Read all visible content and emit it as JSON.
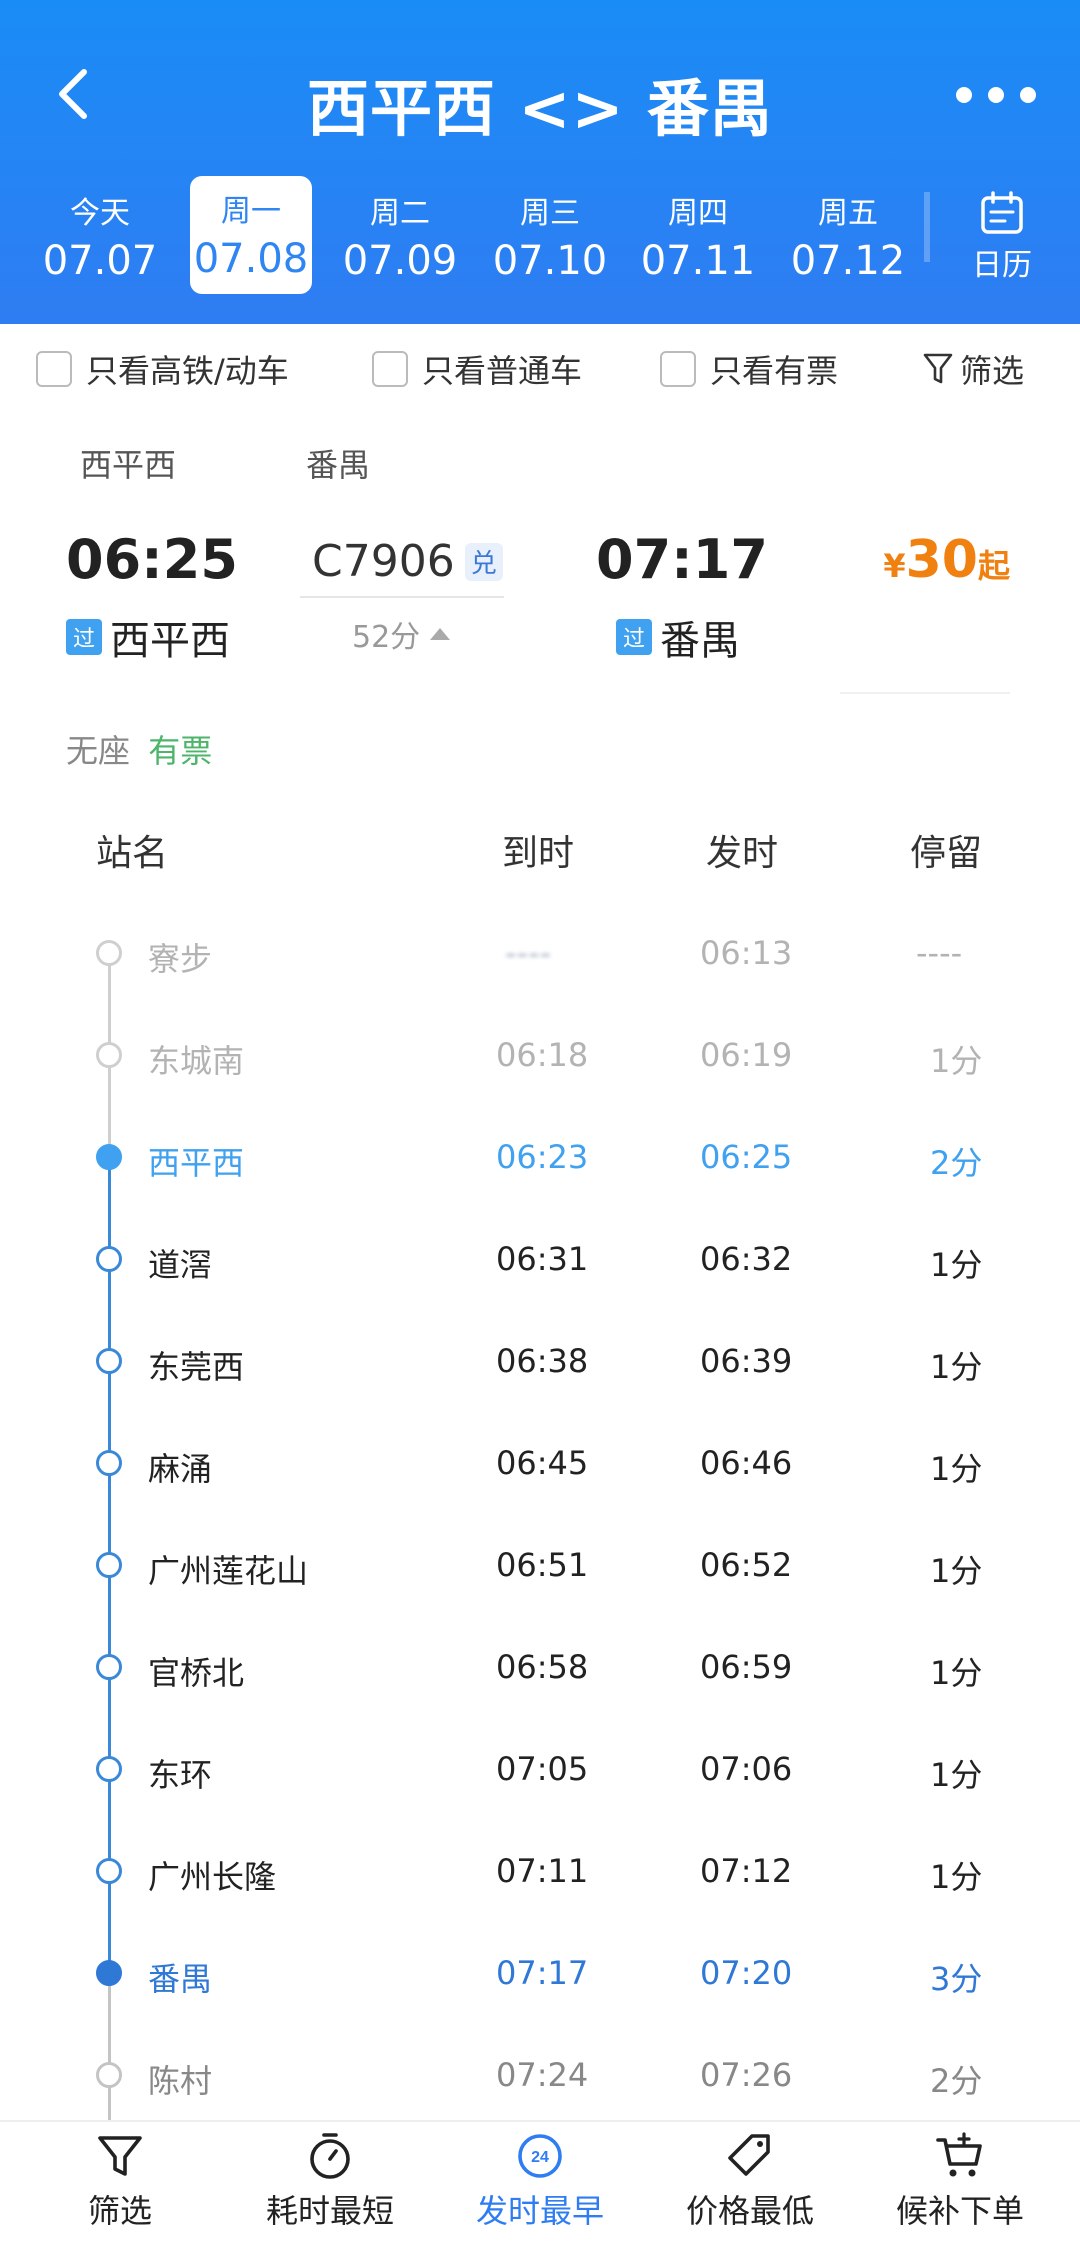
{
  "header": {
    "title": "西平西 <> 番禺",
    "calendar_label": "日历"
  },
  "dates": [
    {
      "weekday": "今天",
      "date": "07.07"
    },
    {
      "weekday": "周一",
      "date": "07.08",
      "active": true
    },
    {
      "weekday": "周二",
      "date": "07.09"
    },
    {
      "weekday": "周三",
      "date": "07.10"
    },
    {
      "weekday": "周四",
      "date": "07.11"
    },
    {
      "weekday": "周五",
      "date": "07.12"
    }
  ],
  "filters": {
    "high_speed": "只看高铁/动车",
    "normal": "只看普通车",
    "available": "只看有票",
    "screen": "筛选"
  },
  "train": {
    "from_label": "西平西",
    "to_label": "番禺",
    "depart_time": "06:25",
    "arrive_time": "07:17",
    "number": "C7906",
    "badge": "兑",
    "duration": "52分",
    "pass_badge": "过",
    "from_station": "西平西",
    "to_station": "番禺",
    "price_symbol": "¥",
    "price": "30",
    "price_suffix": "起",
    "seat_label": "无座",
    "seat_status": "有票"
  },
  "table": {
    "col_station": "站名",
    "col_arrive": "到时",
    "col_depart": "发时",
    "col_stay": "停留"
  },
  "stops": [
    {
      "name": "寮步",
      "arrive": "----",
      "depart": "06:13",
      "stay": "----"
    },
    {
      "name": "东城南",
      "arrive": "06:18",
      "depart": "06:19",
      "stay": "1分"
    },
    {
      "name": "西平西",
      "arrive": "06:23",
      "depart": "06:25",
      "stay": "2分"
    },
    {
      "name": "道滘",
      "arrive": "06:31",
      "depart": "06:32",
      "stay": "1分"
    },
    {
      "name": "东莞西",
      "arrive": "06:38",
      "depart": "06:39",
      "stay": "1分"
    },
    {
      "name": "麻涌",
      "arrive": "06:45",
      "depart": "06:46",
      "stay": "1分"
    },
    {
      "name": "广州莲花山",
      "arrive": "06:51",
      "depart": "06:52",
      "stay": "1分"
    },
    {
      "name": "官桥北",
      "arrive": "06:58",
      "depart": "06:59",
      "stay": "1分"
    },
    {
      "name": "东环",
      "arrive": "07:05",
      "depart": "07:06",
      "stay": "1分"
    },
    {
      "name": "广州长隆",
      "arrive": "07:11",
      "depart": "07:12",
      "stay": "1分"
    },
    {
      "name": "番禺",
      "arrive": "07:17",
      "depart": "07:20",
      "stay": "3分"
    },
    {
      "name": "陈村",
      "arrive": "07:24",
      "depart": "07:26",
      "stay": "2分"
    }
  ],
  "nav": {
    "filter": "筛选",
    "shortest": "耗时最短",
    "earliest": "发时最早",
    "earliest_icon_text": "24",
    "cheapest": "价格最低",
    "waitlist": "候补下单"
  }
}
